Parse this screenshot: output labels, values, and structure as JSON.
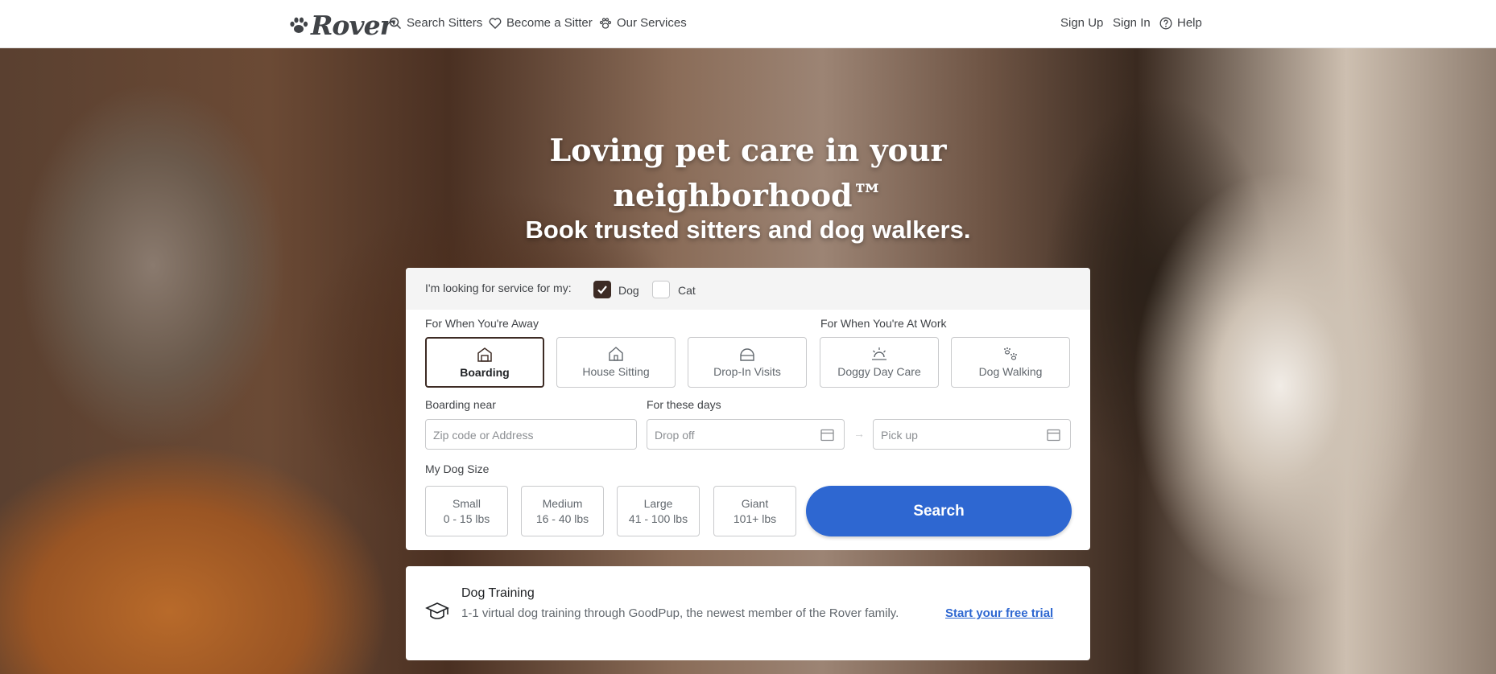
{
  "header": {
    "logo_text": "Rover",
    "nav": {
      "search_sitters": "Search Sitters",
      "become_sitter": "Become a Sitter",
      "our_services": "Our Services"
    },
    "right": {
      "sign_up": "Sign Up",
      "sign_in": "Sign In",
      "help": "Help"
    }
  },
  "hero": {
    "title_line1": "Loving pet care in your",
    "title_line2": "neighborhood™",
    "subtitle": "Book trusted sitters and dog walkers."
  },
  "search_form": {
    "pet_prompt": "I'm looking for service for my:",
    "pets": [
      {
        "label": "Dog",
        "checked": true
      },
      {
        "label": "Cat",
        "checked": false
      }
    ],
    "group_away": "For When You're Away",
    "group_work": "For When You're At Work",
    "services": [
      {
        "label": "Boarding",
        "icon": "boarding-icon",
        "selected": true
      },
      {
        "label": "House Sitting",
        "icon": "house-icon",
        "selected": false
      },
      {
        "label": "Drop-In Visits",
        "icon": "drop-in-icon",
        "selected": false
      },
      {
        "label": "Doggy Day Care",
        "icon": "sun-icon",
        "selected": false
      },
      {
        "label": "Dog Walking",
        "icon": "paws-icon",
        "selected": false
      }
    ],
    "location_label": "Boarding near",
    "location_placeholder": "Zip code or Address",
    "dates_label": "For these days",
    "dropoff_placeholder": "Drop off",
    "pickup_placeholder": "Pick up",
    "arrow": "→",
    "size_label": "My Dog Size",
    "sizes": [
      {
        "name": "Small",
        "range": "0 - 15 lbs"
      },
      {
        "name": "Medium",
        "range": "16 - 40 lbs"
      },
      {
        "name": "Large",
        "range": "41 - 100 lbs"
      },
      {
        "name": "Giant",
        "range": "101+ lbs"
      }
    ],
    "search_button": "Search"
  },
  "training": {
    "title": "Dog Training",
    "description": "1-1 virtual dog training through GoodPup, the newest member of the Rover family.",
    "link": "Start your free trial"
  },
  "colors": {
    "brand_dark": "#3d2b24",
    "accent_blue": "#2e67d1"
  }
}
